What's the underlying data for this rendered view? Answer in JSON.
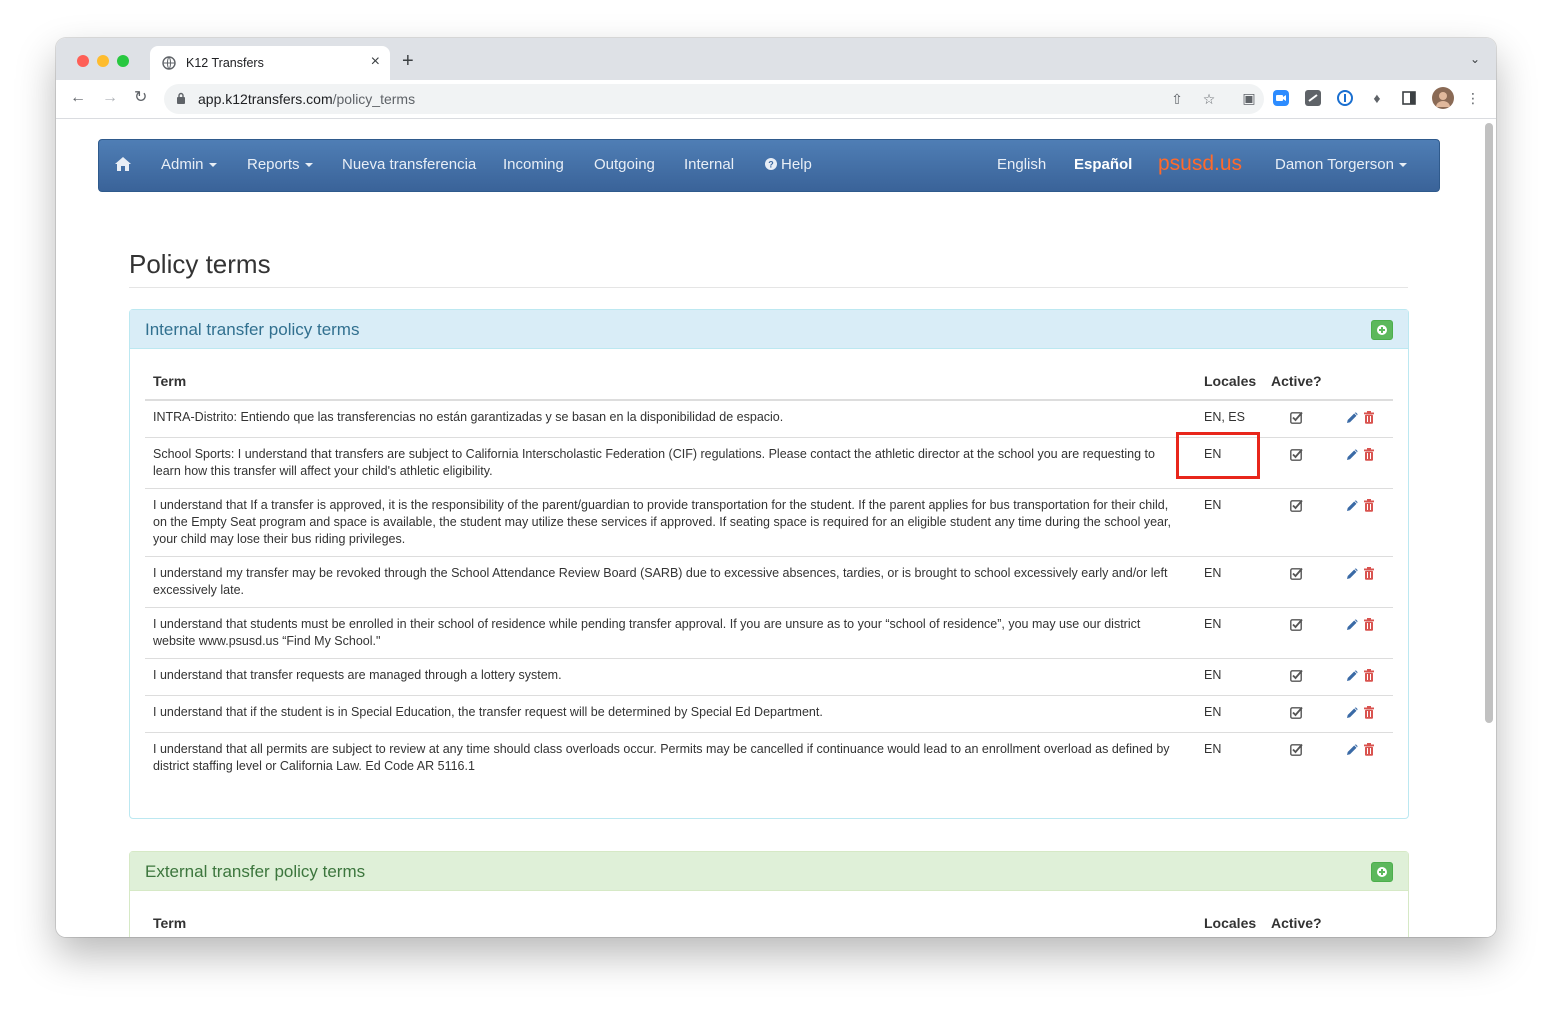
{
  "browser": {
    "tab_title": "K12 Transfers",
    "url_host": "app.k12transfers.com",
    "url_path": "/policy_terms"
  },
  "navbar": {
    "items": [
      {
        "label": "Admin",
        "dropdown": true
      },
      {
        "label": "Reports",
        "dropdown": true
      },
      {
        "label": "Nueva transferencia"
      },
      {
        "label": "Incoming"
      },
      {
        "label": "Outgoing"
      },
      {
        "label": "Internal"
      },
      {
        "label": "Help"
      }
    ],
    "lang_en": "English",
    "lang_es": "Español",
    "brand": "psusd.us",
    "user": "Damon Torgerson",
    "brand_color": "#ff6a2b"
  },
  "page": {
    "title": "Policy terms"
  },
  "internal": {
    "title": "Internal transfer policy terms",
    "col_term": "Term",
    "col_locales": "Locales",
    "col_active": "Active?",
    "rows": [
      {
        "term": "INTRA-Distrito: Entiendo que las transferencias no están garantizadas y se basan en la disponibilidad de espacio.",
        "locales": "EN, ES",
        "active": true
      },
      {
        "term": "School Sports: I understand that transfers are subject to California Interscholastic Federation (CIF) regulations. Please contact the athletic director at the school you are requesting to learn how this transfer will affect your child's athletic eligibility.",
        "locales": "EN",
        "active": true
      },
      {
        "term": "I understand that If a transfer is approved, it is the responsibility of the parent/guardian to provide transportation for the student. If the parent applies for bus transportation for their child, on the Empty Seat program and space is available, the student may utilize these services if approved. If seating space is required for an eligible student any time during the school year, your child may lose their bus riding privileges.",
        "locales": "EN",
        "active": true
      },
      {
        "term": "I understand my transfer may be revoked through the School Attendance Review Board (SARB) due to excessive absences, tardies, or is brought to school excessively early and/or left excessively late.",
        "locales": "EN",
        "active": true
      },
      {
        "term": "I understand that students must be enrolled in their school of residence while pending transfer approval. If you are unsure as to your “school of residence”, you may use our district website www.psusd.us “Find My School.\"",
        "locales": "EN",
        "active": true
      },
      {
        "term": "I understand that transfer requests are managed through a lottery system.",
        "locales": "EN",
        "active": true
      },
      {
        "term": "I understand that if the student is in Special Education, the transfer request will be determined by Special Ed Department.",
        "locales": "EN",
        "active": true
      },
      {
        "term": "I understand that all permits are subject to review at any time should class overloads occur. Permits may be cancelled if continuance would lead to an enrollment overload as defined by district staffing level or California Law. Ed Code AR 5116.1",
        "locales": "EN",
        "active": true
      }
    ]
  },
  "external": {
    "title": "External transfer policy terms",
    "col_term": "Term",
    "col_locales": "Locales",
    "col_active": "Active?"
  }
}
